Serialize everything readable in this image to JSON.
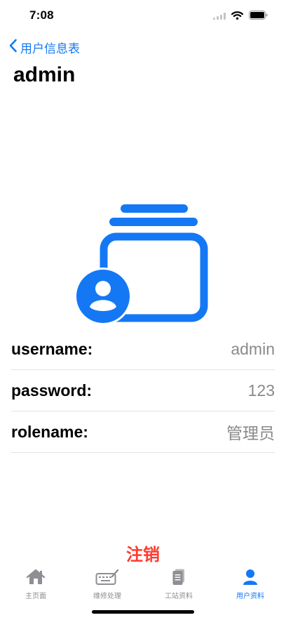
{
  "status_bar": {
    "time": "7:08"
  },
  "nav": {
    "back_label": "用户信息表"
  },
  "page": {
    "title": "admin"
  },
  "profile": {
    "rows": [
      {
        "label": "username:",
        "value": "admin"
      },
      {
        "label": "password:",
        "value": "123"
      },
      {
        "label": "rolename:",
        "value": "管理员"
      }
    ]
  },
  "actions": {
    "logout_label": "注销"
  },
  "tab_bar": {
    "tabs": [
      {
        "label": "主页面",
        "icon": "house-icon"
      },
      {
        "label": "维修处理",
        "icon": "keyboard-pencil-icon"
      },
      {
        "label": "工站资料",
        "icon": "document-icon"
      },
      {
        "label": "用户资料",
        "icon": "person-icon"
      }
    ],
    "active_index": 3
  },
  "colors": {
    "accent": "#1478f5",
    "destructive": "#ff3b30",
    "inactive_tab": "#8e8e93",
    "secondary_text": "#8a8a8e",
    "separator": "#e3e3e6"
  }
}
